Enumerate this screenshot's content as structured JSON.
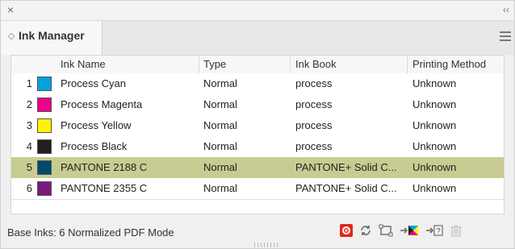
{
  "window": {
    "close_glyph": "×",
    "collapse_glyph": "‹‹"
  },
  "tab": {
    "icon_glyph": "◇",
    "title": "Ink Manager"
  },
  "table": {
    "columns": [
      "Ink Name",
      "Type",
      "Ink Book",
      "Printing Method"
    ],
    "rows": [
      {
        "num": "1",
        "color": "#00a3e0",
        "name": "Process Cyan",
        "type": "Normal",
        "book": "process",
        "method": "Unknown",
        "selected": false
      },
      {
        "num": "2",
        "color": "#ec008c",
        "name": "Process Magenta",
        "type": "Normal",
        "book": "process",
        "method": "Unknown",
        "selected": false
      },
      {
        "num": "3",
        "color": "#fff200",
        "name": "Process Yellow",
        "type": "Normal",
        "book": "process",
        "method": "Unknown",
        "selected": false
      },
      {
        "num": "4",
        "color": "#231f20",
        "name": "Process Black",
        "type": "Normal",
        "book": "process",
        "method": "Unknown",
        "selected": false
      },
      {
        "num": "5",
        "color": "#004b6e",
        "name": "PANTONE 2188 C",
        "type": "Normal",
        "book": "PANTONE+ Solid C...",
        "method": "Unknown",
        "selected": true
      },
      {
        "num": "6",
        "color": "#7c1a7f",
        "name": "PANTONE 2355 C",
        "type": "Normal",
        "book": "PANTONE+ Solid C...",
        "method": "Unknown",
        "selected": false
      }
    ]
  },
  "status": {
    "text": "Base Inks: 6   Normalized PDF Mode"
  },
  "toolbar": {
    "icons": [
      {
        "name": "preview-settings-icon",
        "glyph": "⚙"
      },
      {
        "name": "refresh-icon",
        "glyph": "↻"
      },
      {
        "name": "fit-frame-icon",
        "glyph": "⬚"
      },
      {
        "name": "convert-to-process-icon",
        "glyph": "→⊠"
      },
      {
        "name": "unknown-ink-icon",
        "glyph": "→?"
      },
      {
        "name": "delete-icon",
        "glyph": "🗑"
      }
    ]
  },
  "colors": {
    "selected_row": "#c9cc92",
    "accent_red": "#e1261c"
  }
}
